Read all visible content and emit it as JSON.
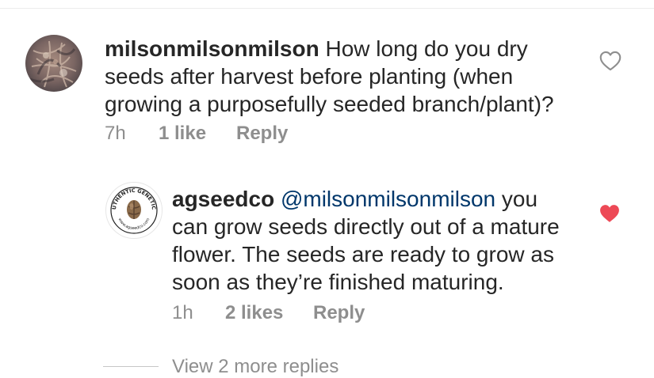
{
  "comments": [
    {
      "username": "milsonmilsonmilson",
      "mention": "",
      "lines": [
        "How long do you dry",
        "seeds after harvest before planting (when",
        "growing a purposefully seeded branch/plant)?"
      ],
      "time": "7h",
      "likes": "1 like",
      "reply": "Reply",
      "liked": false,
      "avatar_icon": "dried-plant-photo"
    },
    {
      "username": "agseedco",
      "mention": "@milsonmilsonmilson",
      "lines": [
        "you",
        "can grow seeds directly out of a mature",
        "flower. The seeds are ready to grow as",
        "soon as they’re finished maturing."
      ],
      "time": "1h",
      "likes": "2 likes",
      "reply": "Reply",
      "liked": true,
      "avatar_icon": "authentic-genetics-seal",
      "avatar_text": {
        "top": "AUTHENTIC GENETICS",
        "bottom": "www.agseedco.com"
      }
    }
  ],
  "view_more": "View 2 more replies",
  "colors": {
    "text": "#262626",
    "meta": "#8e8e8e",
    "mention": "#00376b",
    "liked_heart": "#ed4956",
    "unliked_heart_stroke": "#8e8e8e"
  }
}
